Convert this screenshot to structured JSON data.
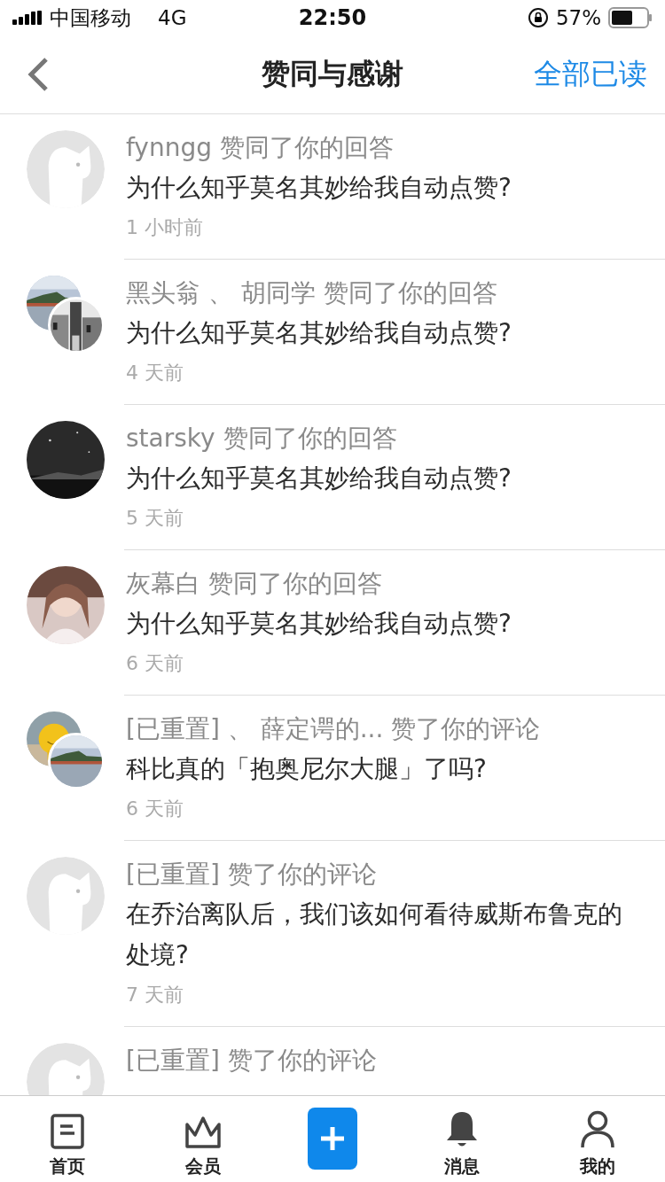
{
  "status_bar": {
    "carrier": "中国移动",
    "network": "4G",
    "time": "22:50",
    "battery": "57%"
  },
  "nav": {
    "title": "赞同与感谢",
    "action": "全部已读"
  },
  "notifications": [
    {
      "avatars": [
        {
          "kind": "default"
        }
      ],
      "header": "fynngg 赞同了你的回答",
      "title": "为什么知乎莫名其妙给我自动点赞?",
      "time": "1 小时前"
    },
    {
      "header": "黑头翁 、 胡同学 赞同了你的回答",
      "title": "为什么知乎莫名其妙给我自动点赞?",
      "time": "4 天前"
    },
    {
      "header": "starsky 赞同了你的回答",
      "title": "为什么知乎莫名其妙给我自动点赞?",
      "time": "5 天前"
    },
    {
      "header": "灰幕白 赞同了你的回答",
      "title": "为什么知乎莫名其妙给我自动点赞?",
      "time": "6 天前"
    },
    {
      "header": "[已重置] 、 薛定谔的... 赞了你的评论",
      "title": "科比真的「抱奥尼尔大腿」了吗?",
      "time": "6 天前"
    },
    {
      "avatars": [
        {
          "kind": "default"
        }
      ],
      "header": "[已重置] 赞了你的评论",
      "title": "在乔治离队后，我们该如何看待威斯布鲁克的处境?",
      "time": "7 天前"
    },
    {
      "avatars": [
        {
          "kind": "default"
        }
      ],
      "header": "[已重置] 赞了你的评论"
    }
  ],
  "tabs": [
    {
      "kind": "home",
      "label": "首页"
    },
    {
      "kind": "vip",
      "label": "会员"
    },
    {
      "kind": "compose"
    },
    {
      "kind": "bell",
      "label": "消息"
    },
    {
      "kind": "profile",
      "label": "我的"
    }
  ]
}
